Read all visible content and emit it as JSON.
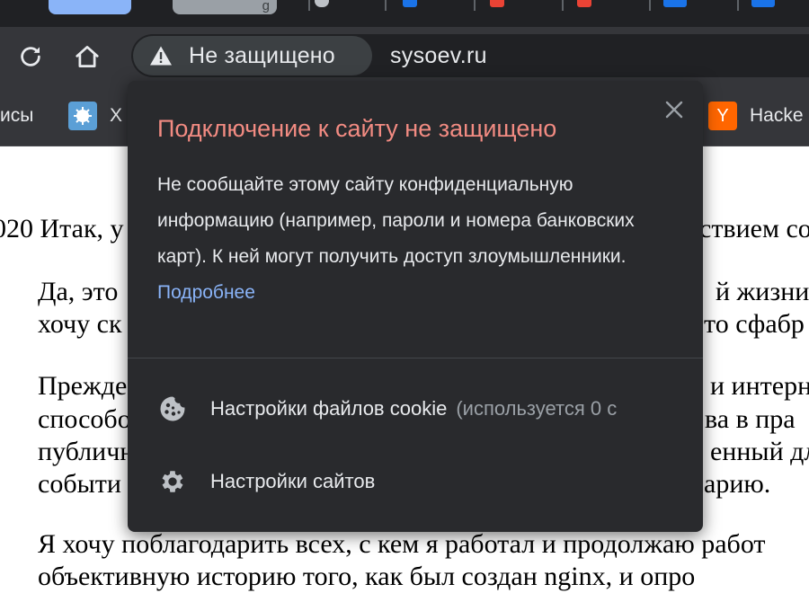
{
  "tabs": {
    "partial_label": "g"
  },
  "toolbar": {
    "reload_icon": "reload-icon",
    "home_icon": "home-icon",
    "security_chip": "Не защищено",
    "url": "sysoev.ru"
  },
  "bookmarks": {
    "item1": "исы",
    "item2": "X",
    "item3_icon_letter": "Y",
    "item3": "Hacke"
  },
  "page": {
    "lines": [
      "020 Итак, у",
      "ствием со",
      "Да, это",
      "й жизни,",
      "хочу ск",
      "то сфабр",
      "Прежде",
      "и интерн",
      "способо",
      "ва в пра",
      "публичн",
      "енный дл",
      "событи",
      "арию.",
      "Я хочу поблагодарить всех, с кем я работал и продолжаю работ",
      "объективную историю того, как был создан nginx, и опро"
    ]
  },
  "popup": {
    "title": "Подключение к сайту не защищено",
    "body": "Не сообщайте этому сайту конфиденциальную информацию (например, пароли и номера банковских карт). К ней могут получить доступ злоумышленники.",
    "link": "Подробнее",
    "cookies_label": "Настройки файлов cookie",
    "cookies_status": "(используется 0 с",
    "site_settings_label": "Настройки сайтов"
  },
  "colors": {
    "accent_warning_title": "#f28b82",
    "link": "#8ab4f8",
    "popup_bg": "#292a2d",
    "toolbar_bg": "#35363a"
  }
}
